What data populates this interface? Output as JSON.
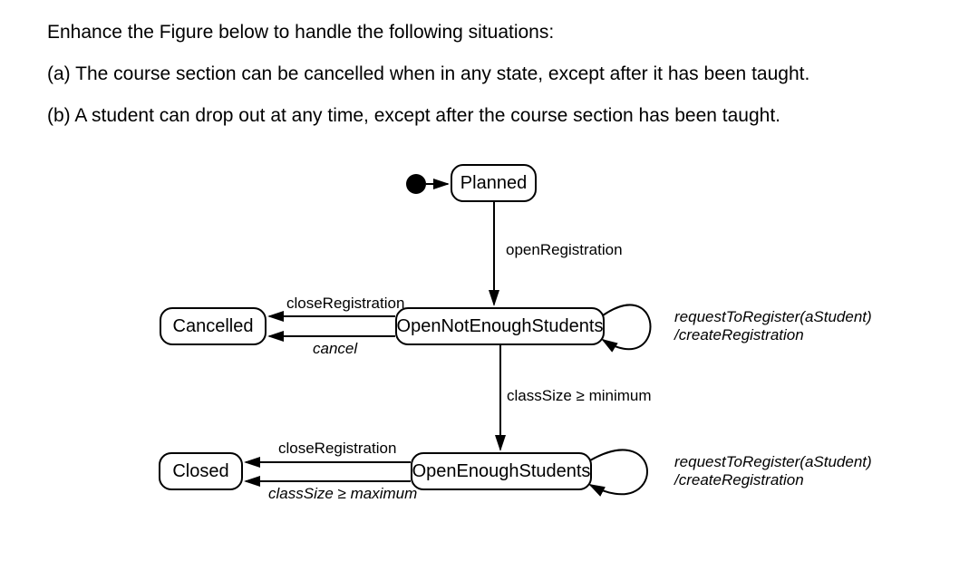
{
  "prompt": {
    "line1": "Enhance the Figure below to handle the following situations:",
    "line2": "(a) The course section can be cancelled when in any state, except after it has been taught.",
    "line3": "(b) A student can drop out at any time, except after the course section has been taught."
  },
  "states": {
    "planned": "Planned",
    "cancelled": "Cancelled",
    "openNotEnough": "OpenNotEnoughStudents",
    "openEnough": "OpenEnoughStudents",
    "closed": "Closed"
  },
  "transitions": {
    "openRegistration": "openRegistration",
    "closeRegistration1": "closeRegistration",
    "cancel": "cancel",
    "classSizeMin": "classSize ≥ minimum",
    "closeRegistration2": "closeRegistration",
    "classSizeMax": "classSize ≥ maximum",
    "selfLoop1_trigger": "requestToRegister(aStudent)",
    "selfLoop1_action": "/createRegistration",
    "selfLoop2_trigger": "requestToRegister(aStudent)",
    "selfLoop2_action": "/createRegistration"
  }
}
